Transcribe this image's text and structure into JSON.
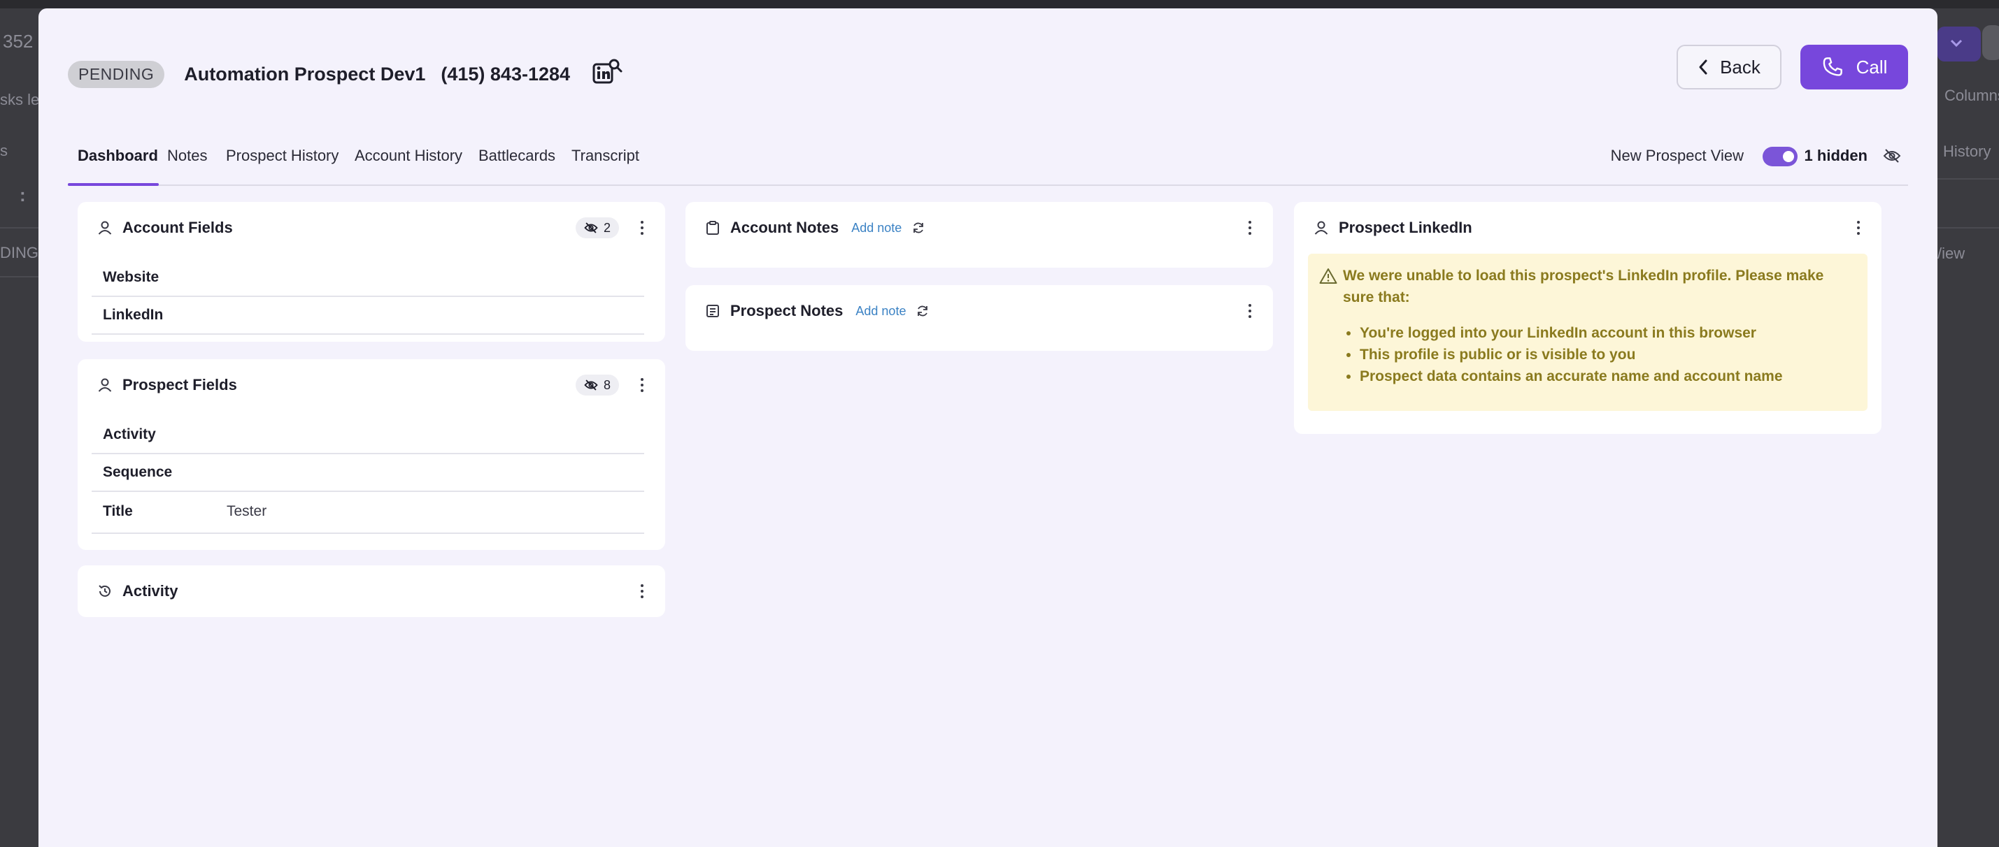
{
  "backdrop": {
    "left_top_text": "352",
    "left_text_2": "sks let",
    "left_text_3": "s",
    "left_text_4": ":",
    "left_text_5": "DING",
    "right_text_1": "Columns",
    "right_text_2": "History",
    "right_text_3": "/iew"
  },
  "header": {
    "status_badge": "PENDING",
    "prospect_name": "Automation Prospect Dev1",
    "phone": "(415) 843-1284",
    "back_label": "Back",
    "call_label": "Call"
  },
  "tabs": [
    {
      "label": "Dashboard",
      "active": true
    },
    {
      "label": "Notes",
      "active": false
    },
    {
      "label": "Prospect History",
      "active": false
    },
    {
      "label": "Account History",
      "active": false
    },
    {
      "label": "Battlecards",
      "active": false
    },
    {
      "label": "Transcript",
      "active": false
    }
  ],
  "view_controls": {
    "new_prospect_view_label": "New Prospect View",
    "new_prospect_view_on": true,
    "hidden_label": "1 hidden"
  },
  "account_fields": {
    "title": "Account Fields",
    "hidden_count": "2",
    "rows": [
      {
        "label": "Website",
        "value": ""
      },
      {
        "label": "LinkedIn",
        "value": ""
      }
    ]
  },
  "prospect_fields": {
    "title": "Prospect Fields",
    "hidden_count": "8",
    "rows": [
      {
        "label": "Activity",
        "value": ""
      },
      {
        "label": "Sequence",
        "value": ""
      },
      {
        "label": "Title",
        "value": "Tester"
      }
    ]
  },
  "activity": {
    "title": "Activity"
  },
  "account_notes": {
    "title": "Account Notes",
    "add_note": "Add note"
  },
  "prospect_notes": {
    "title": "Prospect Notes",
    "add_note": "Add note"
  },
  "prospect_linkedin": {
    "title": "Prospect LinkedIn",
    "warning": "We were unable to load this prospect's LinkedIn profile. Please make sure that:",
    "bullets": [
      "You're logged into your LinkedIn account in this browser",
      "This profile is public or is visible to you",
      "Prospect data contains an accurate name and account name"
    ]
  },
  "colors": {
    "accent": "#7747dc",
    "warning_bg": "#fdf6d8",
    "warning_text": "#8a7a1e",
    "link": "#3b82c4"
  }
}
